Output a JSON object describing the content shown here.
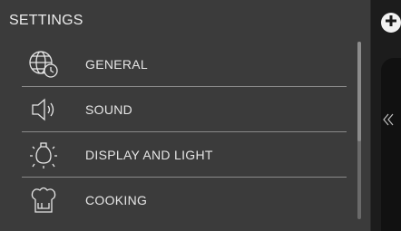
{
  "screen": {
    "title": "SETTINGS"
  },
  "menu": {
    "items": [
      {
        "label": "GENERAL",
        "icon": "globe-clock-icon"
      },
      {
        "label": "SOUND",
        "icon": "speaker-icon"
      },
      {
        "label": "DISPLAY AND LIGHT",
        "icon": "light-bulb-icon"
      },
      {
        "label": "COOKING",
        "icon": "chef-hat-icon"
      }
    ]
  },
  "controls": {
    "add_icon": "plus-circle-icon",
    "collapse_icon": "double-chevron-left-icon"
  },
  "colors": {
    "panel_bg": "#3b3b3b",
    "text": "#e6e6e6",
    "divider": "#8a8a8a",
    "background": "#161616"
  }
}
